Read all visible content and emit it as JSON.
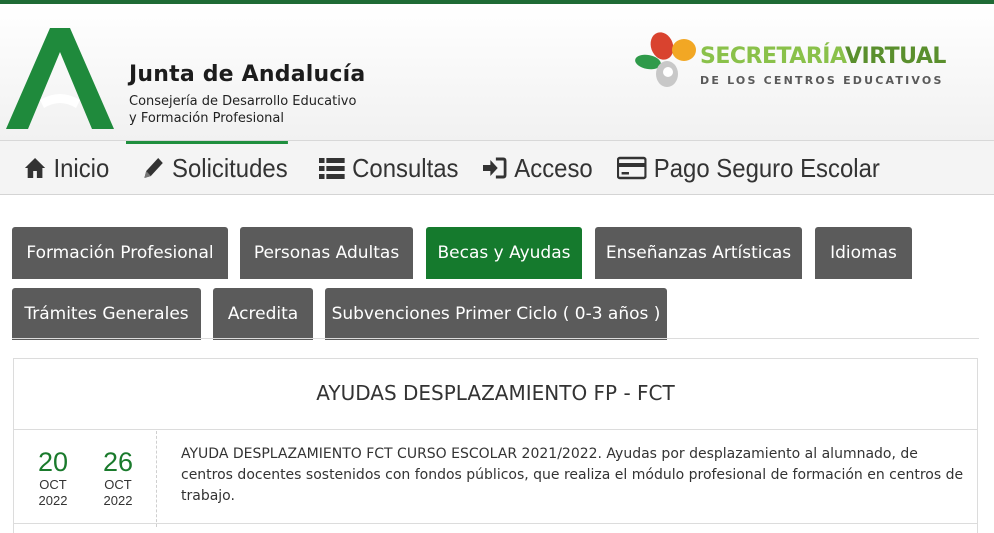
{
  "header": {
    "org_title": "Junta de Andalucía",
    "org_sub_line1": "Consejería de Desarrollo Educativo",
    "org_sub_line2": "y Formación Profesional",
    "sv_title_part1": "SECRETARÍA",
    "sv_title_part2": "VIRTUAL",
    "sv_subtitle": "DE LOS CENTROS EDUCATIVOS"
  },
  "nav": {
    "items": [
      {
        "label": "Inicio",
        "icon": "home-icon"
      },
      {
        "label": "Solicitudes",
        "icon": "pencil-icon"
      },
      {
        "label": "Consultas",
        "icon": "list-icon"
      },
      {
        "label": "Acceso",
        "icon": "sign-in-icon"
      },
      {
        "label": "Pago Seguro Escolar",
        "icon": "credit-card-icon"
      }
    ],
    "active": "Solicitudes"
  },
  "tabs": [
    {
      "label": "Formación Profesional"
    },
    {
      "label": "Personas Adultas"
    },
    {
      "label": "Becas y Ayudas"
    },
    {
      "label": "Enseñanzas Artísticas"
    },
    {
      "label": "Idiomas"
    },
    {
      "label": "Trámites Generales"
    },
    {
      "label": "Acredita"
    },
    {
      "label": "Subvenciones Primer Ciclo ( 0-3 años )"
    }
  ],
  "active_tab": "Becas y Ayudas",
  "section": {
    "title": "AYUDAS DESPLAZAMIENTO FP - FCT",
    "items": [
      {
        "start": {
          "day": "20",
          "month": "OCT",
          "year": "2022"
        },
        "end": {
          "day": "26",
          "month": "OCT",
          "year": "2022"
        },
        "description": "AYUDA DESPLAZAMIENTO FCT CURSO ESCOLAR 2021/2022. Ayudas por desplazamiento al alumnado, de centros docentes sostenidos con fondos públicos, que realiza el módulo profesional de formación en centros de trabajo."
      }
    ]
  },
  "colors": {
    "brand_green": "#157a2d",
    "tab_gray": "#5b5b5b",
    "date_green": "#1a7a2c"
  }
}
